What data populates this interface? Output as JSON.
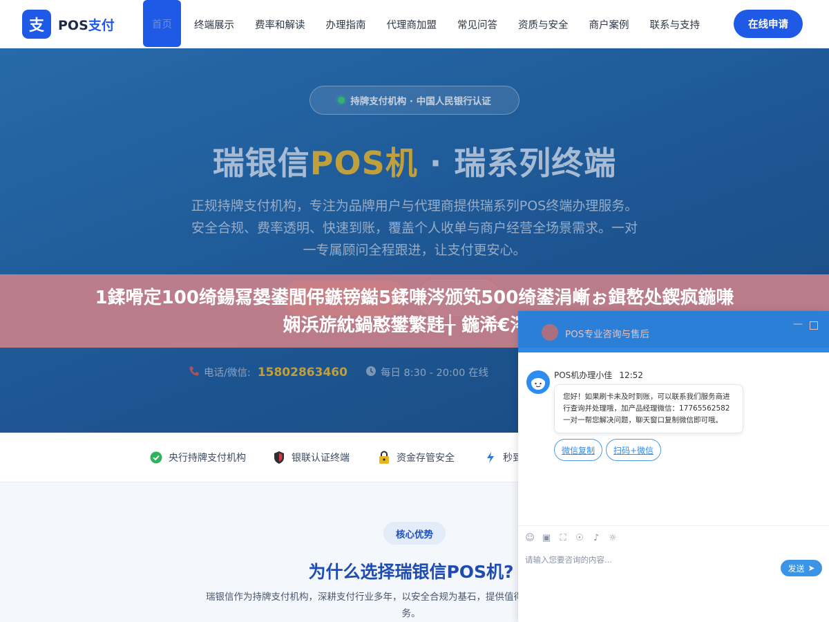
{
  "header": {
    "logo_mark": "支",
    "logo_text_a": "POS",
    "logo_text_b": "支付",
    "nav": [
      "首页",
      "终端展示",
      "费率和解读",
      "办理指南",
      "代理商加盟",
      "常见问答",
      "资质与安全",
      "商户案例",
      "联系与支持"
    ],
    "apply_label": "在线申请"
  },
  "hero": {
    "badge": "持牌支付机构 · 中国人民银行认证",
    "title_a": "瑞银信",
    "title_b": "POS机",
    "title_c": " · 瑞系列终端",
    "desc": "正规持牌支付机构，专注为品牌用户与代理商提供瑞系列POS终端办理服务。安全合规、费率透明、快速到账，覆盖个人收单与商户经营全场景需求。一对一专属顾问全程跟进，让支付更安心。",
    "contact_label": "电话/微信:",
    "contact_phone": "15802863460",
    "hours": "每日 8:30 - 20:00 在线"
  },
  "notice": {
    "line1": "1鍒嗗定100绮鍚冩嫢鍙閭伄鏃镑鐑5鍒嗛涔颁笂500绮鍙涓嶃ぉ鍓嶅处鍥疯鍦嗛",
    "line2": "娴浜旂紞鍋憨鐢繁韪╁ 鍦浠€涔堝"
  },
  "strip": {
    "items": [
      "央行持牌支付机构",
      "银联认证终端",
      "资金存管安全",
      "秒到"
    ]
  },
  "advantages": {
    "tag": "核心优势",
    "title": "为什么选择瑞银信POS机?",
    "desc": "瑞银信作为持牌支付机构，深耕支付行业多年，以安全合规为基石，提供值得信赖的瑞系列终端与服务。"
  },
  "chat": {
    "title": "POS专业咨询与售后",
    "agent_name": "POS机办理小佳",
    "agent_time": "12:52",
    "message": "您好！如果刷卡未及时到账，可以联系我们服务商进行查询并处理哦，加产品经理微信：17765562582 一对一帮您解决问题，聊天窗口复制微信即可哦。",
    "chip1": "微信复制",
    "chip2": "扫码+微信",
    "input_placeholder": "请输入您要咨询的内容...",
    "send_label": "发送"
  }
}
